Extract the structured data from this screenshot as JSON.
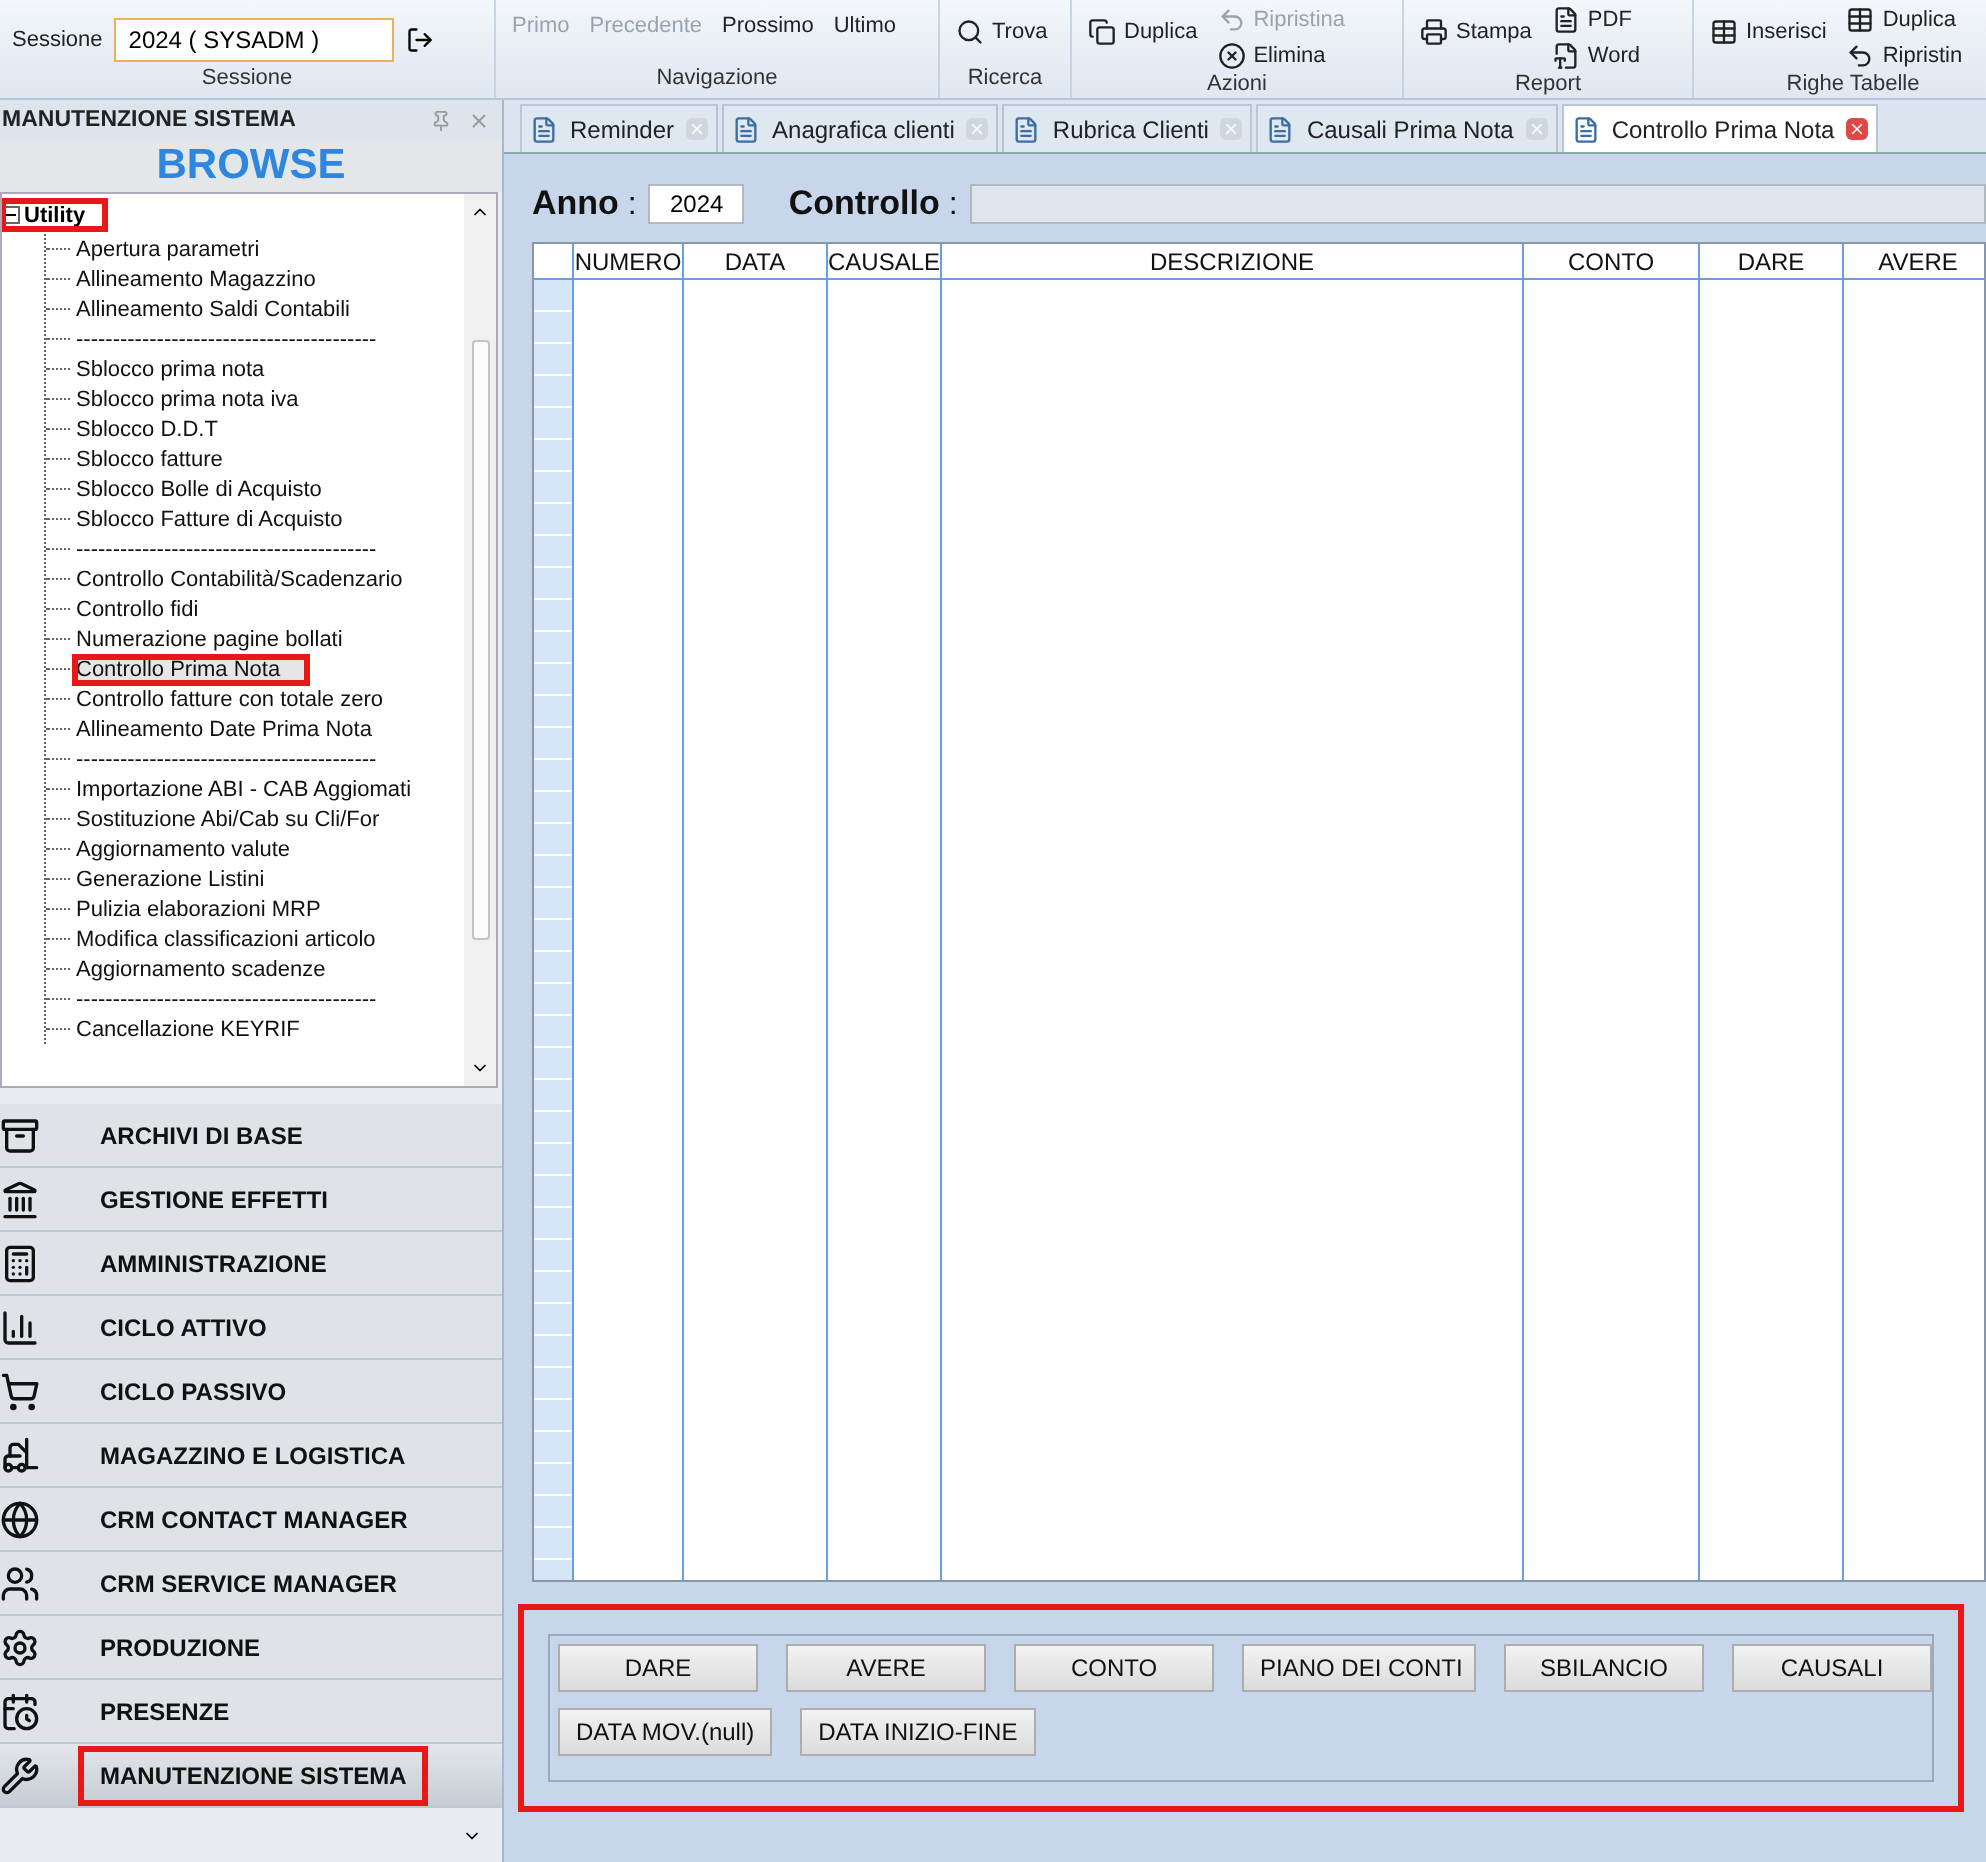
{
  "ribbon": {
    "session": {
      "label": "Sessione",
      "value": "2024 ( SYSADM )"
    },
    "groups": [
      {
        "title": "Sessione"
      },
      {
        "title": "Navigazione",
        "items": [
          {
            "label": "Primo",
            "disabled": true
          },
          {
            "label": "Precedente",
            "disabled": true
          },
          {
            "label": "Prossimo",
            "disabled": false
          },
          {
            "label": "Ultimo",
            "disabled": false
          }
        ]
      },
      {
        "title": "Ricerca",
        "items": [
          {
            "label": "Trova",
            "disabled": false
          }
        ]
      },
      {
        "title": "Azioni",
        "items": [
          {
            "label": "Duplica",
            "disabled": false
          },
          {
            "label": "Ripristina",
            "disabled": true
          },
          {
            "label": "Elimina",
            "disabled": false
          }
        ]
      },
      {
        "title": "Report",
        "items": [
          {
            "label": "Stampa",
            "disabled": false
          },
          {
            "label": "PDF",
            "disabled": false
          },
          {
            "label": "Word",
            "disabled": false
          }
        ]
      },
      {
        "title": "Righe Tabelle",
        "items": [
          {
            "label": "Inserisci",
            "disabled": false
          },
          {
            "label": "Duplica",
            "disabled": false
          },
          {
            "label": "Ripristin",
            "disabled": false
          }
        ]
      }
    ]
  },
  "sidebar": {
    "title": "MANUTENZIONE SISTEMA",
    "browse": "BROWSE",
    "tree": [
      {
        "label": "Utility",
        "expanded": true,
        "highlighted": true,
        "children": [
          {
            "label": "Apertura parametri",
            "selected": false,
            "highlighted": false
          },
          {
            "label": "Allineamento Magazzino",
            "selected": false,
            "highlighted": false
          },
          {
            "label": "Allineamento Saldi Contabili",
            "selected": false,
            "highlighted": false
          },
          {
            "label": "-----------------------------------------",
            "selected": false,
            "highlighted": false
          },
          {
            "label": "Sblocco prima nota",
            "selected": false,
            "highlighted": false
          },
          {
            "label": "Sblocco prima nota iva",
            "selected": false,
            "highlighted": false
          },
          {
            "label": "Sblocco D.D.T",
            "selected": false,
            "highlighted": false
          },
          {
            "label": "Sblocco fatture",
            "selected": false,
            "highlighted": false
          },
          {
            "label": "Sblocco Bolle di Acquisto",
            "selected": false,
            "highlighted": false
          },
          {
            "label": "Sblocco Fatture di Acquisto",
            "selected": false,
            "highlighted": false
          },
          {
            "label": "-----------------------------------------",
            "selected": false,
            "highlighted": false
          },
          {
            "label": "Controllo Contabilità/Scadenzario",
            "selected": false,
            "highlighted": false
          },
          {
            "label": "Controllo fidi",
            "selected": false,
            "highlighted": false
          },
          {
            "label": "Numerazione pagine bollati",
            "selected": false,
            "highlighted": false
          },
          {
            "label": "Controllo Prima Nota",
            "selected": true,
            "highlighted": true
          },
          {
            "label": "Controllo fatture con totale zero",
            "selected": false,
            "highlighted": false
          },
          {
            "label": "Allineamento Date Prima Nota",
            "selected": false,
            "highlighted": false
          },
          {
            "label": "-----------------------------------------",
            "selected": false,
            "highlighted": false
          },
          {
            "label": "Importazione ABI - CAB Aggiomati",
            "selected": false,
            "highlighted": false
          },
          {
            "label": "Sostituzione Abi/Cab su Cli/For",
            "selected": false,
            "highlighted": false
          },
          {
            "label": "Aggiornamento valute",
            "selected": false,
            "highlighted": false
          },
          {
            "label": "Generazione Listini",
            "selected": false,
            "highlighted": false
          },
          {
            "label": "Pulizia elaborazioni MRP",
            "selected": false,
            "highlighted": false
          },
          {
            "label": "Modifica classificazioni articolo",
            "selected": false,
            "highlighted": false
          },
          {
            "label": "Aggiornamento scadenze",
            "selected": false,
            "highlighted": false
          },
          {
            "label": "-----------------------------------------",
            "selected": false,
            "highlighted": false
          },
          {
            "label": "Cancellazione KEYRIF",
            "selected": false,
            "highlighted": false
          }
        ]
      }
    ],
    "modules": [
      {
        "label": "ARCHIVI DI BASE",
        "selected": false,
        "highlighted": false
      },
      {
        "label": "GESTIONE EFFETTI",
        "selected": false,
        "highlighted": false
      },
      {
        "label": "AMMINISTRAZIONE",
        "selected": false,
        "highlighted": false
      },
      {
        "label": "CICLO ATTIVO",
        "selected": false,
        "highlighted": false
      },
      {
        "label": "CICLO PASSIVO",
        "selected": false,
        "highlighted": false
      },
      {
        "label": "MAGAZZINO E LOGISTICA",
        "selected": false,
        "highlighted": false
      },
      {
        "label": "CRM CONTACT MANAGER",
        "selected": false,
        "highlighted": false
      },
      {
        "label": "CRM SERVICE MANAGER",
        "selected": false,
        "highlighted": false
      },
      {
        "label": "PRODUZIONE",
        "selected": false,
        "highlighted": false
      },
      {
        "label": "PRESENZE",
        "selected": false,
        "highlighted": false
      },
      {
        "label": "MANUTENZIONE SISTEMA",
        "selected": true,
        "highlighted": true
      }
    ]
  },
  "tabs": [
    {
      "label": "Reminder",
      "selected": false
    },
    {
      "label": "Anagrafica clienti",
      "selected": false
    },
    {
      "label": "Rubrica Clienti",
      "selected": false
    },
    {
      "label": "Causali Prima Nota",
      "selected": false
    },
    {
      "label": "Controllo Prima Nota",
      "selected": true
    }
  ],
  "form": {
    "anno_label": "**Anno** :",
    "anno_value": "2024",
    "controllo_label": "**Controllo** :"
  },
  "table": {
    "columns": [
      "NUMERO",
      "DATA",
      "CAUSALE",
      "DESCRIZIONE",
      "CONTO",
      "DARE",
      "AVERE"
    ]
  },
  "actions": {
    "highlighted": true,
    "buttons": [
      [
        "DARE",
        "AVERE",
        "CONTO",
        "PIANO DEI CONTI",
        "SBILANCIO",
        "CAUSALI"
      ],
      [
        "DATA MOV.(null)",
        "DATA INIZIO-FINE"
      ]
    ]
  }
}
